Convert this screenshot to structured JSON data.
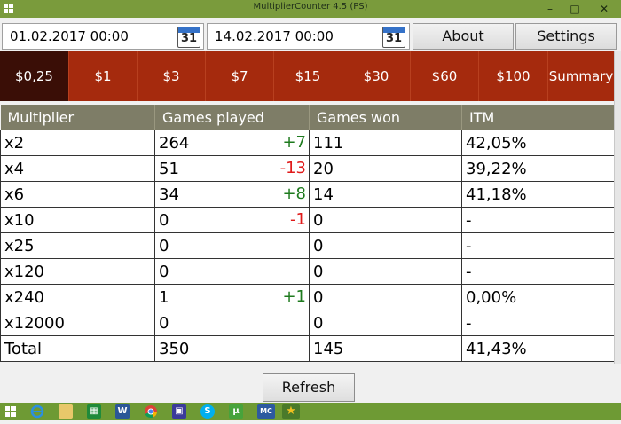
{
  "window": {
    "title": "MultiplierCounter 4.5 (PS)",
    "min": "–",
    "max": "□",
    "close": "✕"
  },
  "dates": {
    "from": "01.02.2017 00:00",
    "to": "14.02.2017 00:00",
    "calendar_day": "31"
  },
  "buttons": {
    "about": "About",
    "settings": "Settings",
    "refresh": "Refresh"
  },
  "tabs": [
    "$0,25",
    "$1",
    "$3",
    "$7",
    "$15",
    "$30",
    "$60",
    "$100",
    "Summary"
  ],
  "active_tab": "$0,25",
  "table": {
    "headers": [
      "Multiplier",
      "Games played",
      "Games won",
      "ITM"
    ],
    "rows": [
      {
        "multiplier": "x2",
        "played": "264",
        "delta": "+7",
        "won": "111",
        "itm": "42,05%"
      },
      {
        "multiplier": "x4",
        "played": "51",
        "delta": "-13",
        "won": "20",
        "itm": "39,22%"
      },
      {
        "multiplier": "x6",
        "played": "34",
        "delta": "+8",
        "won": "14",
        "itm": "41,18%"
      },
      {
        "multiplier": "x10",
        "played": "0",
        "delta": "-1",
        "won": "0",
        "itm": "-"
      },
      {
        "multiplier": "x25",
        "played": "0",
        "delta": "",
        "won": "0",
        "itm": "-"
      },
      {
        "multiplier": "x120",
        "played": "0",
        "delta": "",
        "won": "0",
        "itm": "-"
      },
      {
        "multiplier": "x240",
        "played": "1",
        "delta": "+1",
        "won": "0",
        "itm": "0,00%"
      },
      {
        "multiplier": "x12000",
        "played": "0",
        "delta": "",
        "won": "0",
        "itm": "-"
      }
    ],
    "total": {
      "multiplier": "Total",
      "played": "350",
      "won": "145",
      "itm": "41,43%"
    }
  },
  "colors": {
    "titlebar": "#7a9b3c",
    "tabs": "#a52a0d",
    "active_tab": "#3a0e06",
    "header": "#7e7d67",
    "positive": "#1e7a1e",
    "negative": "#e01a1a"
  },
  "taskbar": {
    "icons": [
      "windows-start-icon",
      "internet-explorer-icon",
      "file-explorer-icon",
      "store-icon",
      "word-icon",
      "chrome-icon",
      "save-disk-icon",
      "skype-icon",
      "utorrent-icon",
      "mc-app-icon",
      "star-app-icon"
    ]
  }
}
